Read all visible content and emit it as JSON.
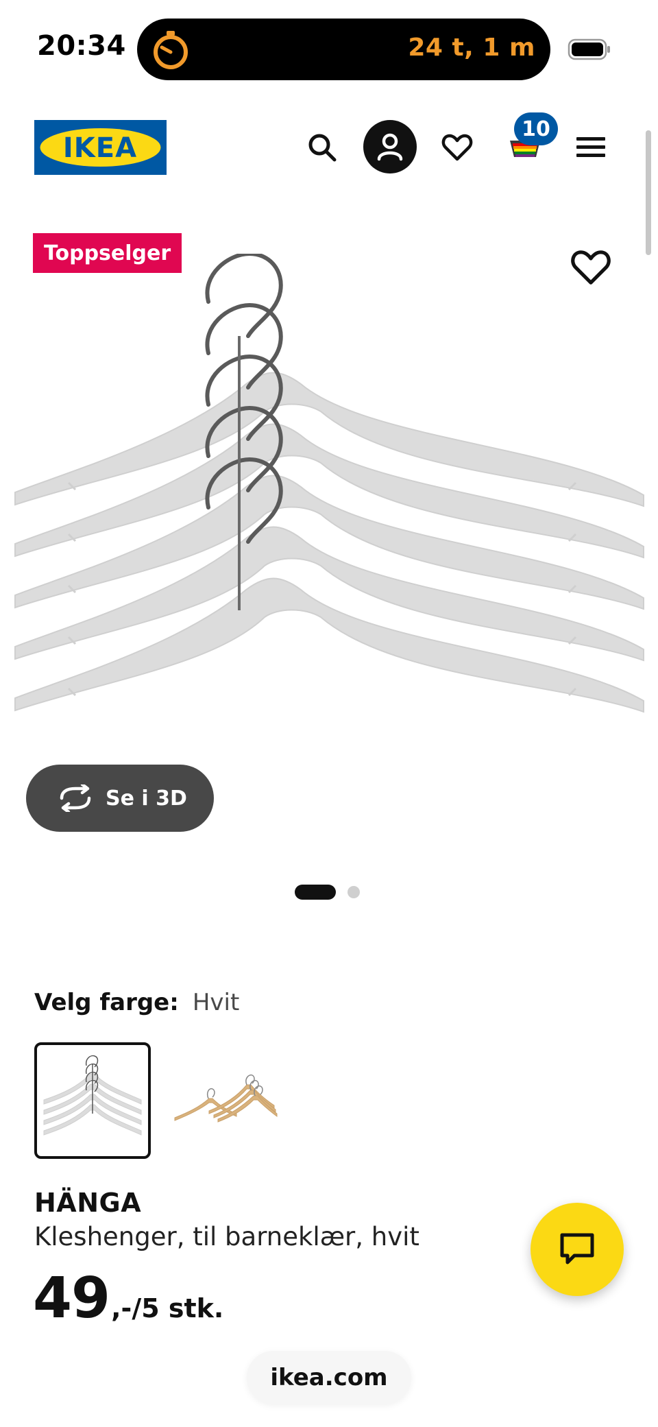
{
  "status_bar": {
    "time": "20:34",
    "timer": "24 t, 1 m"
  },
  "header": {
    "logo_text": "IKEA",
    "cart_count": "10"
  },
  "gallery": {
    "badge": "Toppselger",
    "view_3d_label": "Se i 3D",
    "slide_index": 1,
    "slide_count": 2
  },
  "color_picker": {
    "label": "Velg farge:",
    "selected": "Hvit"
  },
  "product": {
    "name": "HÄNGA",
    "description": "Kleshenger, til barneklær, hvit",
    "price_main": "49",
    "price_suffix": ",-/5 stk."
  },
  "browser": {
    "url": "ikea.com"
  },
  "colors": {
    "ikea_blue": "#0058a3",
    "ikea_yellow": "#fbd914",
    "badge_red": "#e00751",
    "timer_orange": "#f19a2b"
  }
}
